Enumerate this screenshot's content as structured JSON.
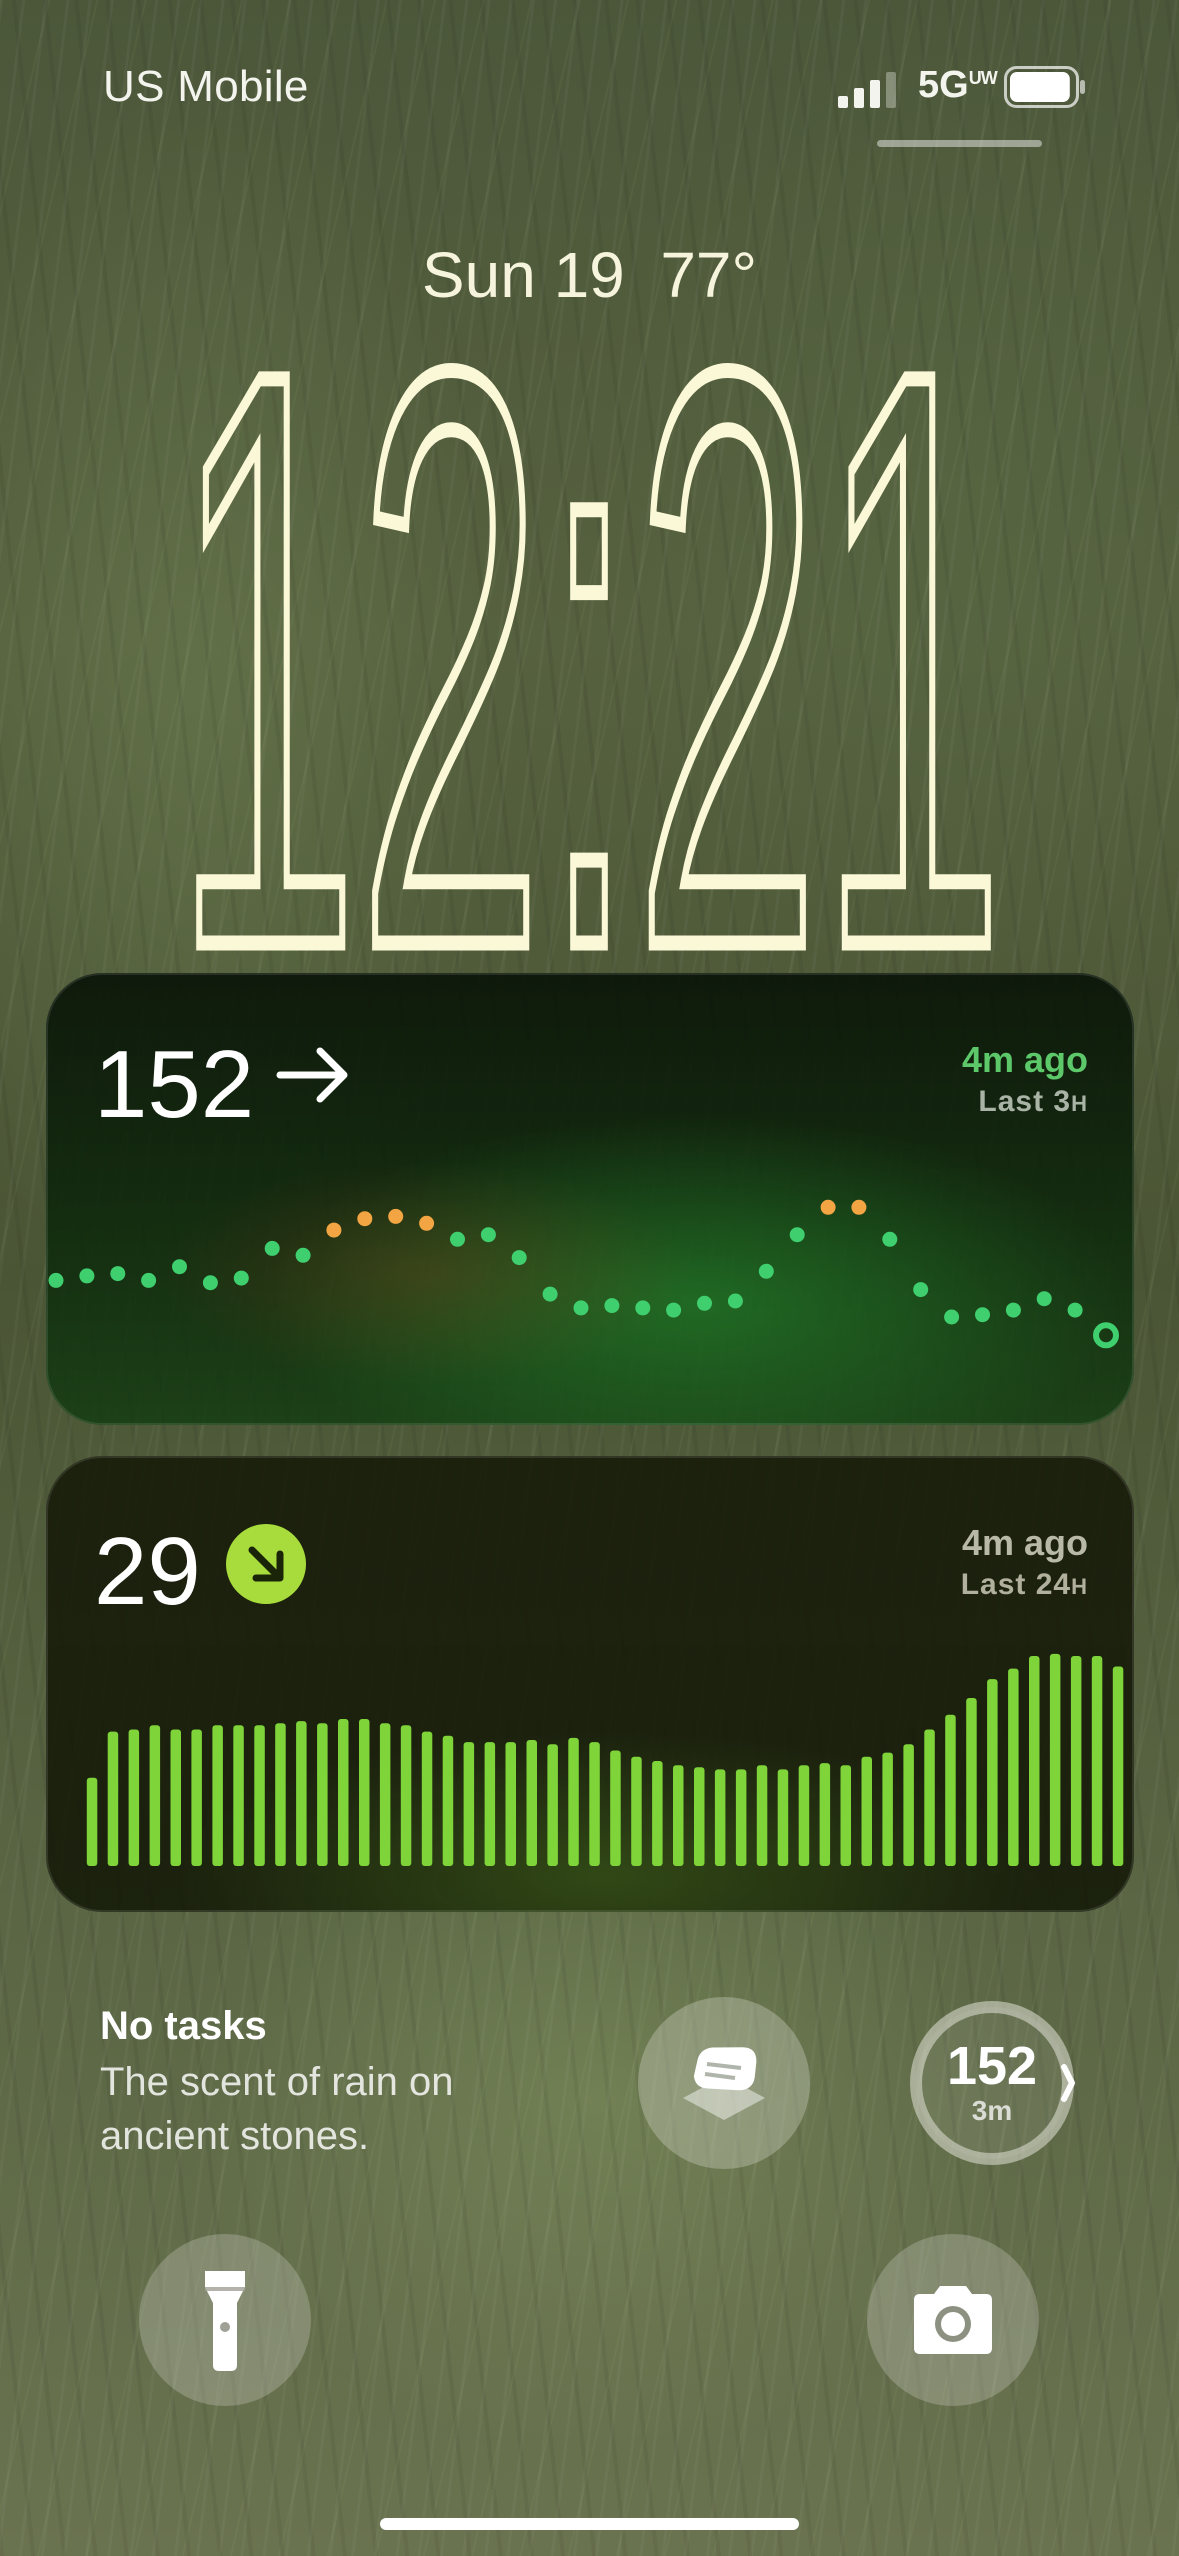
{
  "status_bar": {
    "carrier": "US Mobile",
    "network": "5G",
    "network_suffix": "UW",
    "signal_bars": 3,
    "battery_level": 0.95
  },
  "lock_screen": {
    "date": "Sun 19",
    "temperature": "77°",
    "time": "12:21"
  },
  "glucose_widget": {
    "value": "152",
    "trend": "arrow-right-icon",
    "updated": "4m ago",
    "range_label": "Last 3",
    "range_unit": "H",
    "colors": {
      "in_range": "#3fcf6e",
      "high": "#f2a542",
      "updated": "#5dc86a"
    }
  },
  "bars_widget": {
    "value": "29",
    "trend": "arrow-down-right-icon",
    "updated": "4m ago",
    "range_label": "Last 24",
    "range_unit": "H",
    "colors": {
      "bar": "#7fd43a",
      "trend_badge": "#a8dc3c"
    }
  },
  "reminder": {
    "title": "No tasks",
    "text": "The scent of rain on ancient stones."
  },
  "glucose_complication": {
    "value": "152",
    "age": "3m"
  },
  "chart_data": [
    {
      "type": "scatter",
      "title": "",
      "x": [
        0,
        1,
        2,
        3,
        4,
        5,
        6,
        7,
        8,
        9,
        10,
        11,
        12,
        13,
        14,
        15,
        16,
        17,
        18,
        19,
        20,
        21,
        22,
        23,
        24,
        25,
        26,
        27,
        28,
        29,
        30,
        31,
        32,
        33,
        34
      ],
      "values": [
        118,
        120,
        121,
        118,
        124,
        117,
        119,
        132,
        129,
        140,
        145,
        146,
        143,
        136,
        138,
        128,
        112,
        106,
        107,
        106,
        105,
        108,
        109,
        122,
        138,
        150,
        150,
        136,
        114,
        102,
        103,
        105,
        110,
        105,
        94
      ],
      "high_threshold": 140,
      "series_colors": {
        "in_range": "#3fcf6e",
        "high": "#f2a542"
      }
    },
    {
      "type": "bar",
      "title": "",
      "values": [
        42,
        64,
        65,
        67,
        65,
        65,
        67,
        67,
        67,
        68,
        69,
        68,
        70,
        70,
        68,
        67,
        64,
        62,
        59,
        59,
        59,
        60,
        58,
        61,
        59,
        55,
        52,
        50,
        48,
        47,
        46,
        46,
        48,
        46,
        48,
        49,
        48,
        52,
        54,
        58,
        65,
        72,
        80,
        89,
        94,
        100,
        101,
        100,
        100,
        95
      ],
      "color": "#7fd43a"
    }
  ]
}
